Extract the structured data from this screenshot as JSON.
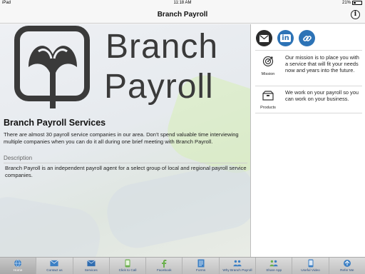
{
  "status_bar": {
    "carrier": "iPad",
    "time": "11:18 AM",
    "battery": "21%"
  },
  "nav": {
    "title": "Branch Payroll",
    "info_icon": "info-icon"
  },
  "logo": {
    "line1": "Branch",
    "line2": "Payroll"
  },
  "main": {
    "title": "Branch Payroll Services",
    "intro": "There are almost 30 payroll service companies in our area. Don’t spend valuable time interviewing multiple companies when you can do it all during one brief meeting with Branch Payroll.",
    "description_label": "Description",
    "description": "Branch Payroll is an independent payroll agent for a select group of local and regional payroll service companies."
  },
  "side": {
    "social_icons": [
      "email-icon",
      "linkedin-icon",
      "link-icon"
    ],
    "mission_label": "Mission",
    "mission_text": "Our mission is to place you with a service that will fit your needs now and years into the future.",
    "products_label": "Products",
    "products_text": "We work on your payroll so you can work on your business."
  },
  "tabs": [
    {
      "label": "Home",
      "icon": "globe-icon",
      "color": "#3b7fc4"
    },
    {
      "label": "Contact us",
      "icon": "mail-icon",
      "color": "#3b7fc4"
    },
    {
      "label": "Services",
      "icon": "envelope-icon",
      "color": "#3b7fc4"
    },
    {
      "label": "Click to Call",
      "icon": "phone-icon",
      "color": "#6ab04c"
    },
    {
      "label": "Facebook",
      "icon": "facebook-icon",
      "color": "#6ab04c"
    },
    {
      "label": "Forms",
      "icon": "forms-icon",
      "color": "#3b7fc4"
    },
    {
      "label": "Why Branch Payroll",
      "icon": "people-icon",
      "color": "#3b7fc4"
    },
    {
      "label": "Share App",
      "icon": "share-icon",
      "color": "#6ab04c"
    },
    {
      "label": "Useful Video",
      "icon": "video-icon",
      "color": "#3b7fc4"
    },
    {
      "label": "Refer Me",
      "icon": "refer-icon",
      "color": "#3b7fc4"
    }
  ],
  "active_tab": "Home"
}
